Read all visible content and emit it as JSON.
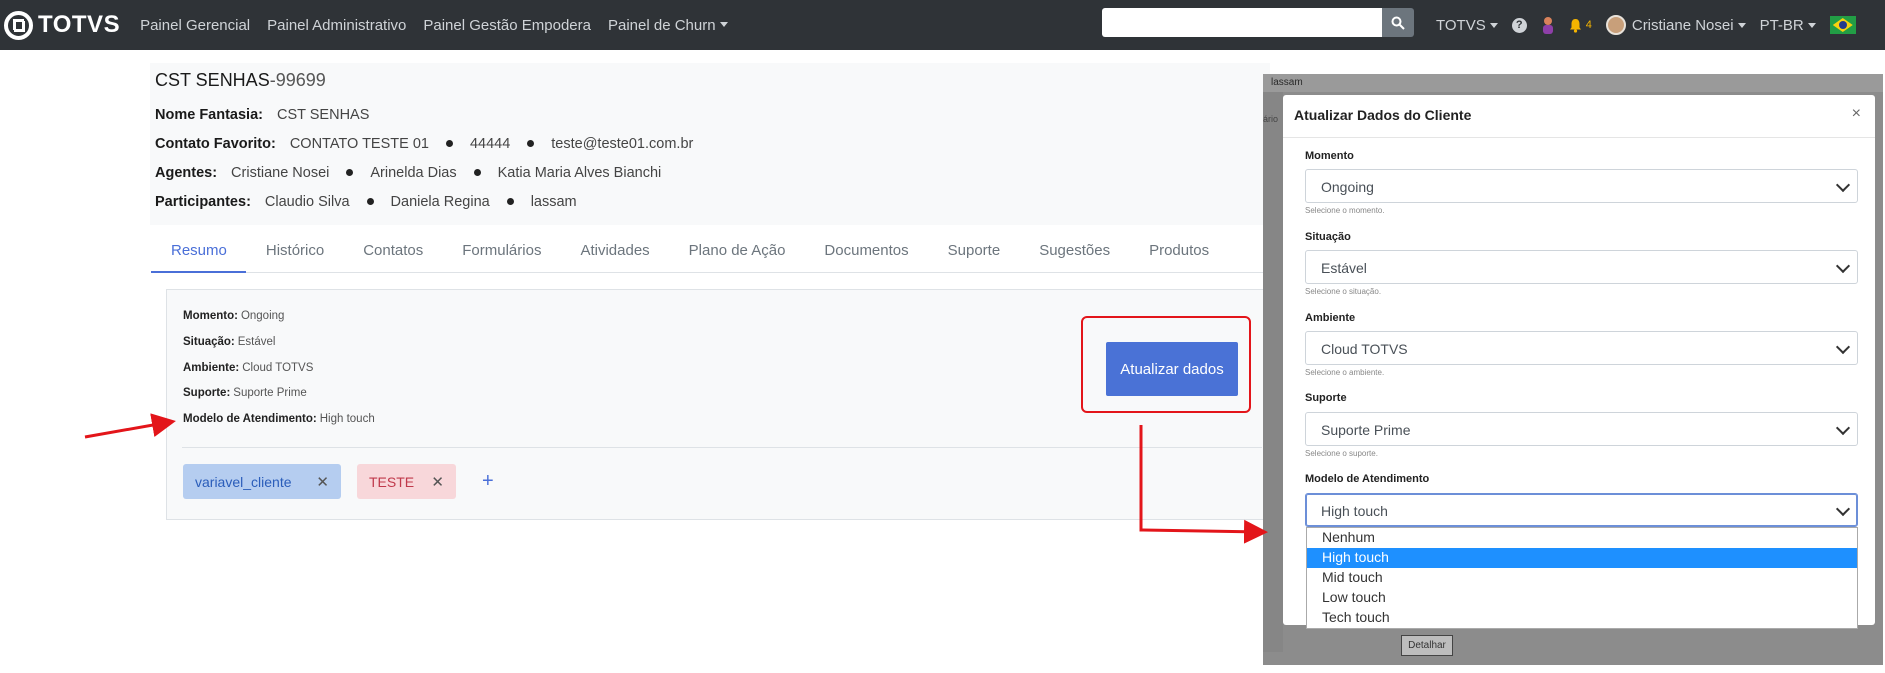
{
  "navbar": {
    "brand": "TOTVS",
    "links": [
      "Painel Gerencial",
      "Painel Administrativo",
      "Painel Gestão Empodera",
      "Painel de Churn"
    ],
    "search_placeholder": "",
    "org": "TOTVS",
    "notification_count": "4",
    "user_name": "Cristiane Nosei",
    "language": "PT-BR"
  },
  "client": {
    "name": "CST SENHAS",
    "code": "-99699",
    "fantasy_label": "Nome Fantasia:",
    "fantasy_value": "CST SENHAS",
    "contact_label": "Contato Favorito:",
    "contact_name": "CONTATO TESTE 01",
    "contact_phone": "44444",
    "contact_email": "teste@teste01.com.br",
    "agents_label": "Agentes:",
    "agents": [
      "Cristiane Nosei",
      "Arinelda Dias",
      "Katia Maria Alves Bianchi"
    ],
    "participants_label": "Participantes:",
    "participants": [
      "Claudio Silva",
      "Daniela Regina",
      "lassam"
    ]
  },
  "tabs": [
    "Resumo",
    "Histórico",
    "Contatos",
    "Formulários",
    "Atividades",
    "Plano de Ação",
    "Documentos",
    "Suporte",
    "Sugestões",
    "Produtos"
  ],
  "summary": {
    "moment_label": "Momento:",
    "moment_value": "Ongoing",
    "situation_label": "Situação:",
    "situation_value": "Estável",
    "environment_label": "Ambiente:",
    "environment_value": "Cloud TOTVS",
    "support_label": "Suporte:",
    "support_value": "Suporte Prime",
    "model_label": "Modelo de Atendimento:",
    "model_value": "High touch",
    "tags": [
      "variavel_cliente",
      "TESTE"
    ],
    "update_button": "Atualizar dados"
  },
  "backdrop": {
    "top_text": "lassam",
    "side_text": "ário"
  },
  "modal": {
    "title": "Atualizar Dados do Cliente",
    "close": "×",
    "fields": [
      {
        "label": "Momento",
        "value": "Ongoing",
        "hint": "Selecione o momento."
      },
      {
        "label": "Situação",
        "value": "Estável",
        "hint": "Selecione o situação."
      },
      {
        "label": "Ambiente",
        "value": "Cloud TOTVS",
        "hint": "Selecione o ambiente."
      },
      {
        "label": "Suporte",
        "value": "Suporte Prime",
        "hint": "Selecione o suporte."
      },
      {
        "label": "Modelo de Atendimento",
        "value": "High touch"
      }
    ],
    "dropdown_options": [
      "Nenhum",
      "High touch",
      "Mid touch",
      "Low touch",
      "Tech touch"
    ],
    "selected_option": "High touch"
  },
  "underlying_button": "Detalhar",
  "colors": {
    "accent": "#4a6fd8",
    "navbar": "#2f3337",
    "highlight": "#e3151a",
    "selected_option": "#1e90ff"
  }
}
